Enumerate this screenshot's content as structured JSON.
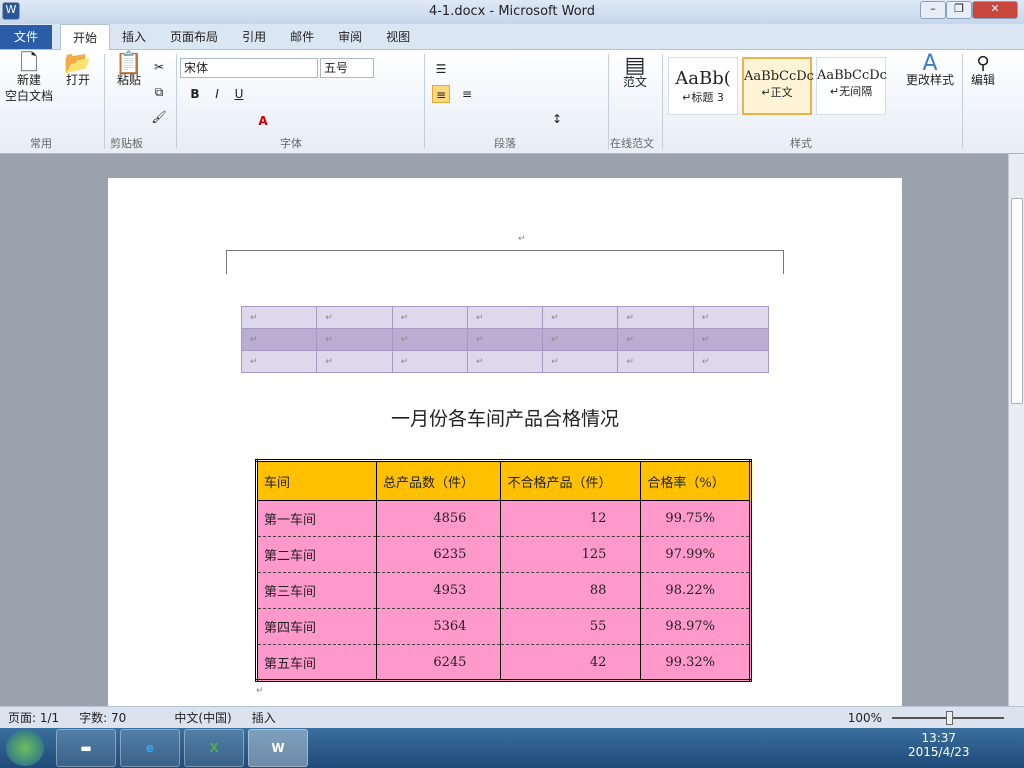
{
  "title": "4-1.docx - Microsoft Word",
  "tabs": [
    "文件",
    "开始",
    "插入",
    "页面布局",
    "引用",
    "邮件",
    "审阅",
    "视图"
  ],
  "ribbon": {
    "new": "新建",
    "blank": "空白文档",
    "open": "打开",
    "paste": "粘贴",
    "font": "宋体",
    "size": "五号",
    "styles": [
      {
        "sample": "AaBb(",
        "name": "标题 3"
      },
      {
        "sample": "AaBbCcDc",
        "name": "正文"
      },
      {
        "sample": "AaBbCcDc",
        "name": "无间隔"
      }
    ],
    "change": "更改样式",
    "edit": "编辑",
    "fanwen": "范文",
    "groups": [
      "常用",
      "剪贴板",
      "字体",
      "段落",
      "在线范文",
      "样式"
    ]
  },
  "doc": {
    "heading": "一月份各车间产品合格情况",
    "table": {
      "headers": [
        "车间",
        "总产品数（件）",
        "不合格产品（件）",
        "合格率（%）"
      ],
      "rows": [
        [
          "第一车间",
          "4856",
          "12",
          "99.75%"
        ],
        [
          "第二车间",
          "6235",
          "125",
          "97.99%"
        ],
        [
          "第三车间",
          "4953",
          "88",
          "98.22%"
        ],
        [
          "第四车间",
          "5364",
          "55",
          "98.97%"
        ],
        [
          "第五车间",
          "6245",
          "42",
          "99.32%"
        ]
      ]
    }
  },
  "status": {
    "page": "页面: 1/1",
    "words": "字数: 70",
    "lang": "中文(中国)",
    "ins": "插入",
    "zoom": "100%"
  },
  "clock": {
    "time": "13:37",
    "date": "2015/4/23"
  },
  "colors": {
    "header": "#ffc000",
    "row": "#ff99cc"
  }
}
